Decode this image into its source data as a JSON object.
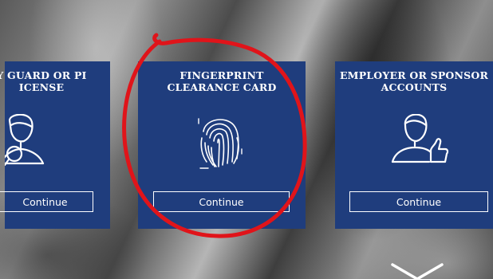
{
  "cards": [
    {
      "title": "Y GUARD OR PI\nICENSE",
      "button_label": "Continue",
      "icon": "guard-person-icon"
    },
    {
      "title": "FINGERPRINT\nCLEARANCE CARD",
      "button_label": "Continue",
      "icon": "fingerprint-icon"
    },
    {
      "title": "EMPLOYER OR SPONSOR\nACCOUNTS",
      "button_label": "Continue",
      "icon": "person-thumbs-up-icon"
    }
  ],
  "colors": {
    "card_bg": "#1f3d7d",
    "annotation": "#e0141a"
  },
  "scroll_hint_icon": "chevron-down-icon"
}
